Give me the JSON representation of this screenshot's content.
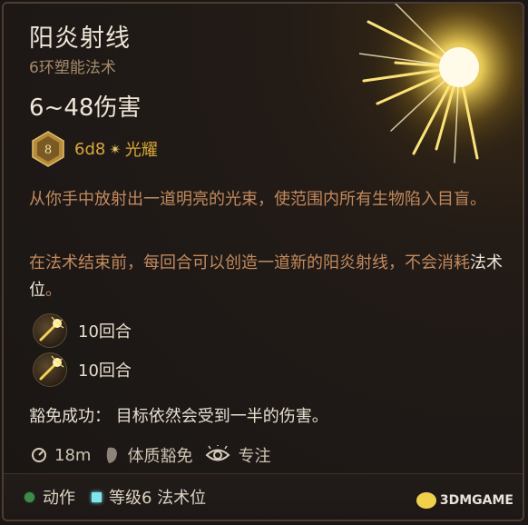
{
  "spell": {
    "name": "阳炎射线",
    "subtitle": "6环塑能法术",
    "damage": "6~48伤害",
    "dice_face": "8",
    "dice_roll": "6d8",
    "damage_type": "光耀",
    "description_1": "从你手中放射出一道明亮的光束，使范围内所有生物陷入目盲。",
    "description_2_plain": "在法术结束前，每回合可以创造一道新的阳炎射线，不会消耗",
    "description_2_highlight": "法术位",
    "description_2_end": "。",
    "turns": [
      {
        "label": "10回合"
      },
      {
        "label": "10回合"
      }
    ],
    "save_text": "豁免成功： 目标依然会受到一半的伤害。",
    "range": "18m",
    "save_type": "体质豁免",
    "concentration": "专注"
  },
  "footer": {
    "action": "动作",
    "slot": "等级6 法术位",
    "watermark": "3DMGAME"
  },
  "colors": {
    "accent_gold": "#d9a83a",
    "description": "#c28a5e",
    "action_dot": "#3f8a4a",
    "slot_square": "#7fe6ee"
  }
}
